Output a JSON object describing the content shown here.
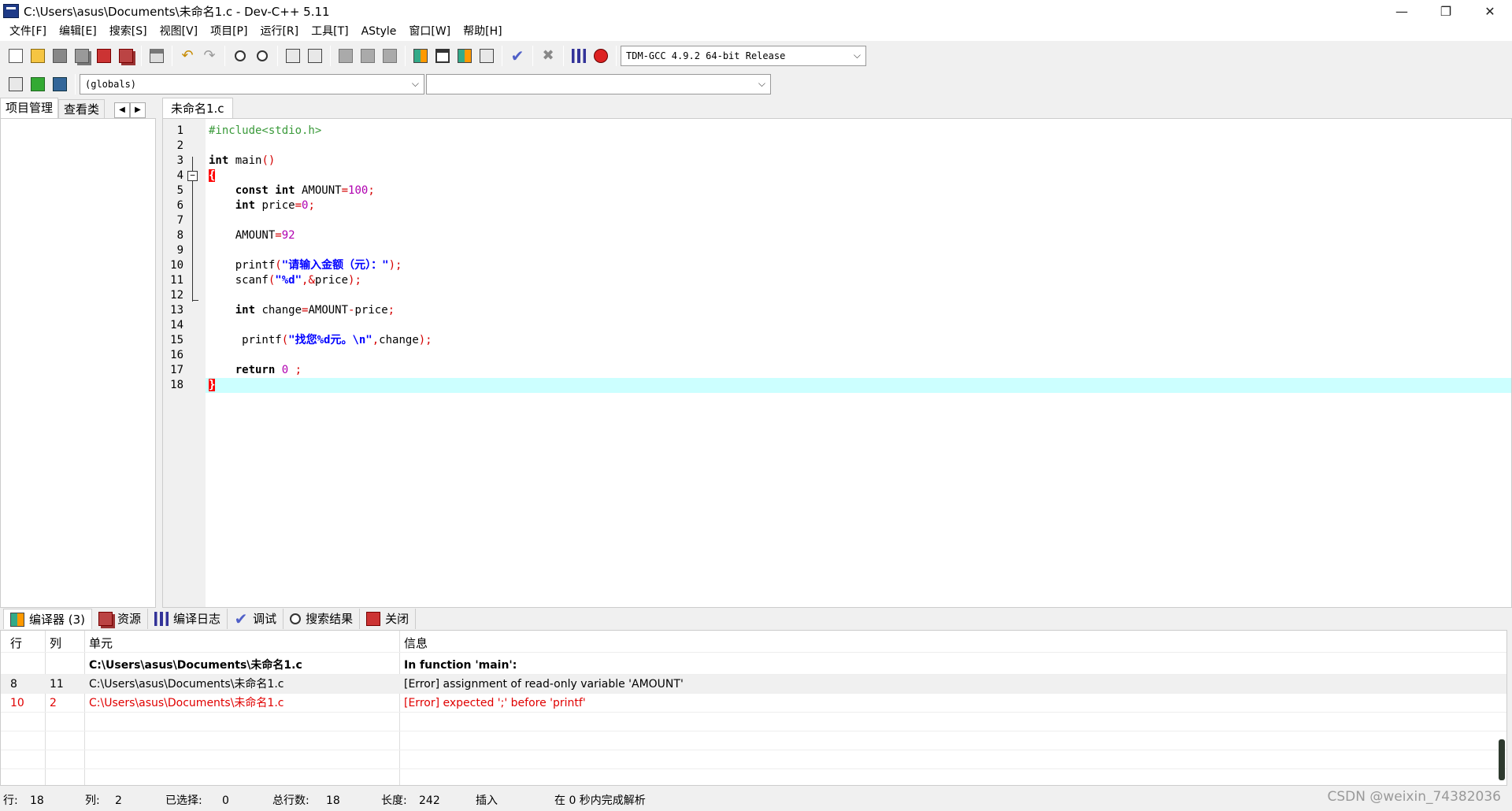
{
  "window": {
    "title": "C:\\Users\\asus\\Documents\\未命名1.c - Dev-C++ 5.11",
    "minimize": "—",
    "restore": "❐",
    "close": "✕"
  },
  "menu": [
    "文件[F]",
    "编辑[E]",
    "搜索[S]",
    "视图[V]",
    "项目[P]",
    "运行[R]",
    "工具[T]",
    "AStyle",
    "窗口[W]",
    "帮助[H]"
  ],
  "toolbar": {
    "compiler": "TDM-GCC 4.9.2 64-bit Release",
    "scope": "(globals)",
    "symbol": ""
  },
  "left_tabs": [
    "项目管理",
    "查看类"
  ],
  "editor": {
    "file_tab": "未命名1.c",
    "line_numbers": [
      "1",
      "2",
      "3",
      "4",
      "5",
      "6",
      "7",
      "8",
      "9",
      "10",
      "11",
      "12",
      "13",
      "14",
      "15",
      "16",
      "17",
      "18"
    ]
  },
  "bottom_tabs": [
    "编译器 (3)",
    "资源",
    "编译日志",
    "调试",
    "搜索结果",
    "关闭"
  ],
  "messages": {
    "headers": {
      "line": "行",
      "col": "列",
      "unit": "单元",
      "info": "信息"
    },
    "rows": [
      {
        "line": "",
        "col": "",
        "unit": "C:\\Users\\asus\\Documents\\未命名1.c",
        "info": "In function 'main':"
      },
      {
        "line": "8",
        "col": "11",
        "unit": "C:\\Users\\asus\\Documents\\未命名1.c",
        "info": "[Error] assignment of read-only variable 'AMOUNT'"
      },
      {
        "line": "10",
        "col": "2",
        "unit": "C:\\Users\\asus\\Documents\\未命名1.c",
        "info": "[Error] expected ';' before 'printf'"
      }
    ]
  },
  "status": {
    "row_label": "行:",
    "row_value": "18",
    "col_label": "列:",
    "col_value": "2",
    "sel_label": "已选择:",
    "sel_value": "0",
    "lines_label": "总行数:",
    "lines_value": "18",
    "len_label": "长度:",
    "len_value": "242",
    "mode": "插入",
    "parse": "在 0 秒内完成解析"
  },
  "watermark": "CSDN @weixin_74382036"
}
